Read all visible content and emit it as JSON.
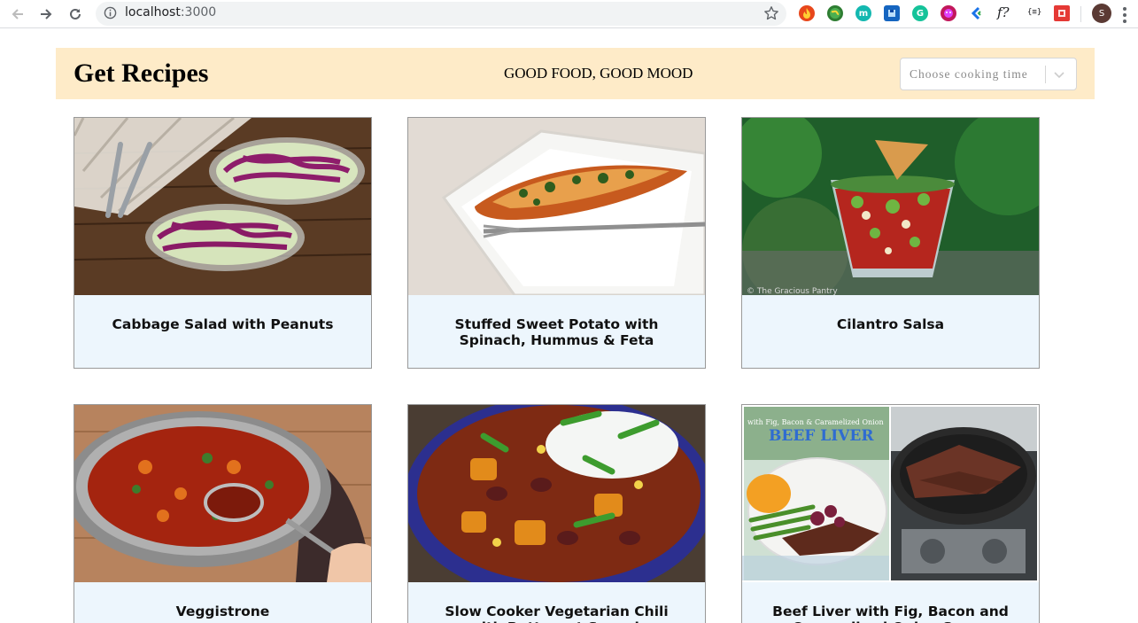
{
  "browser": {
    "url_host": "localhost",
    "url_port": ":3000",
    "avatar_initial": "S",
    "ext_f_label": "f?",
    "ext_json_label": "{≡}"
  },
  "header": {
    "title": "Get Recipes",
    "tagline": "GOOD FOOD, GOOD MOOD",
    "time_select_placeholder": "Choose cooking time"
  },
  "recipes": [
    {
      "name": "Cabbage Salad with Peanuts"
    },
    {
      "name": "Stuffed Sweet Potato with Spinach, Hummus & Feta"
    },
    {
      "name": "Cilantro Salsa"
    },
    {
      "name": "Veggistrone"
    },
    {
      "name": "Slow Cooker Vegetarian Chili with Butternut Squash"
    },
    {
      "name": "Beef Liver with Fig, Bacon and Caramelized Onion Sauce"
    }
  ],
  "image_text": {
    "salsa_watermark": "© The Gracious Pantry",
    "liver_banner": "BEEF LIVER",
    "liver_subbanner": "with Fig, Bacon & Caramelized Onion"
  }
}
